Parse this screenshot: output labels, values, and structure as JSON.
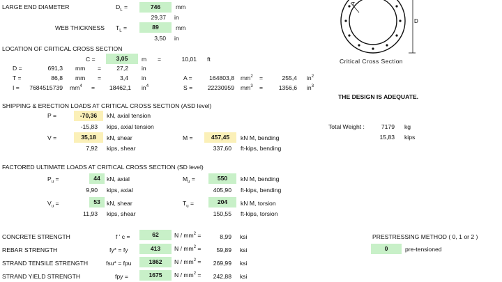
{
  "geometry": {
    "large_end_label": "LARGE END DIAMETER",
    "dl_sym": "D",
    "dl_sub": "L",
    "eq": "=",
    "dl_mm": "746",
    "mm": "mm",
    "dl_in": "29,37",
    "in": "in",
    "web_label": "WEB THICKNESS",
    "tl_sym": "T",
    "tl_sub": "L",
    "tl_mm": "89",
    "tl_in": "3,50"
  },
  "location": {
    "title": "LOCATION OF CRITICAL CROSS SECTION",
    "c_label": "C =",
    "c_val": "3,05",
    "m": "m",
    "c_ft": "10,01",
    "ft": "ft",
    "d_label": "D =",
    "d_mm": "691,3",
    "d_in": "27,2",
    "t_label": "T =",
    "t_mm": "86,8",
    "t_in": "3,4",
    "a_label": "A =",
    "a_mm": "164803,8",
    "mm2": "mm",
    "a_in": "255,4",
    "in2": "in",
    "i_label": "I =",
    "i_mm": "7684515739",
    "mm4": "mm",
    "i_in": "18462,1",
    "in4": "in",
    "s_label": "S =",
    "s_mm": "22230959",
    "mm3": "mm",
    "s_in": "1356,6",
    "in3": "in",
    "exp2": "2",
    "exp3": "3",
    "exp4": "4"
  },
  "shipping": {
    "title": "SHIPPING & ERECTION LOADS AT CRITICAL CROSS SECTION (ASD level)",
    "p_label": "P =",
    "p_kn": "-70,36",
    "p_kn_unit": "kN, axial tension",
    "p_kips": "-15,83",
    "p_kips_unit": "kips, axial tension",
    "v_label": "V =",
    "v_kn": "35,18",
    "v_kn_unit": "kN, shear",
    "v_kips": "7,92",
    "v_kips_unit": "kips, shear",
    "m_label": "M =",
    "m_kn": "457,45",
    "m_kn_unit": "kN M, bending",
    "m_ftk": "337,60",
    "m_ftk_unit": "ft-kips, bending"
  },
  "factored": {
    "title": "FACTORED ULTIMATE LOADS AT CRITICAL CROSS SECTION (SD level)",
    "pu_sym": "P",
    "pu_sub": "u",
    "pu_kn": "44",
    "pu_kn_unit": "kN, axial",
    "pu_kips": "9,90",
    "pu_kips_unit": "kips, axial",
    "vu_sym": "V",
    "vu_sub": "u",
    "vu_kn": "53",
    "vu_kn_unit": "kN, shear",
    "vu_kips": "11,93",
    "vu_kips_unit": "kips, shear",
    "mu_sym": "M",
    "mu_sub": "u",
    "mu_kn": "550",
    "mu_kn_unit": "kN M, bending",
    "mu_ftk": "405,90",
    "mu_ftk_unit": "ft-kips, bending",
    "tu_sym": "T",
    "tu_sub": "u",
    "tu_kn": "204",
    "tu_kn_unit": "kN M, torsion",
    "tu_ftk": "150,55",
    "tu_ftk_unit": "ft-kips, torsion"
  },
  "materials": {
    "concrete_label": "CONCRETE STRENGTH",
    "concrete_sym": "f ' c =",
    "concrete_val": "62",
    "concrete_ksi": "8,99",
    "rebar_label": "REBAR STRENGTH",
    "rebar_sym": "fy* = fy",
    "rebar_val": "413",
    "rebar_ksi": "59,89",
    "strand_t_label": "STRAND TENSILE STRENGTH",
    "strand_t_sym": "fsu* = fpu",
    "strand_t_val": "1862",
    "strand_t_ksi": "269,99",
    "strand_y_label": "STRAND YIELD STRENGTH",
    "strand_y_sym": "fpy =",
    "strand_y_val": "1675",
    "strand_y_ksi": "242,88",
    "nmm": "N / mm",
    "nmm_tail": "=",
    "ksi": "ksi"
  },
  "right": {
    "diagram_caption": "Critical Cross Section",
    "diagram_t": "T",
    "diagram_d": "D",
    "adequate": "THE DESIGN IS ADEQUATE.",
    "weight_label": "Total Weight :",
    "weight_kg": "7179",
    "kg": "kg",
    "weight_kips": "15,83",
    "kips": "kips",
    "prestress_label": "PRESTRESSING METHOD ( 0, 1 or 2 )",
    "prestress_val": "0",
    "prestress_desc": "pre-tensioned"
  },
  "colors": {
    "input_green": "#c8f0c8",
    "input_yellow": "#fbf0b8"
  }
}
